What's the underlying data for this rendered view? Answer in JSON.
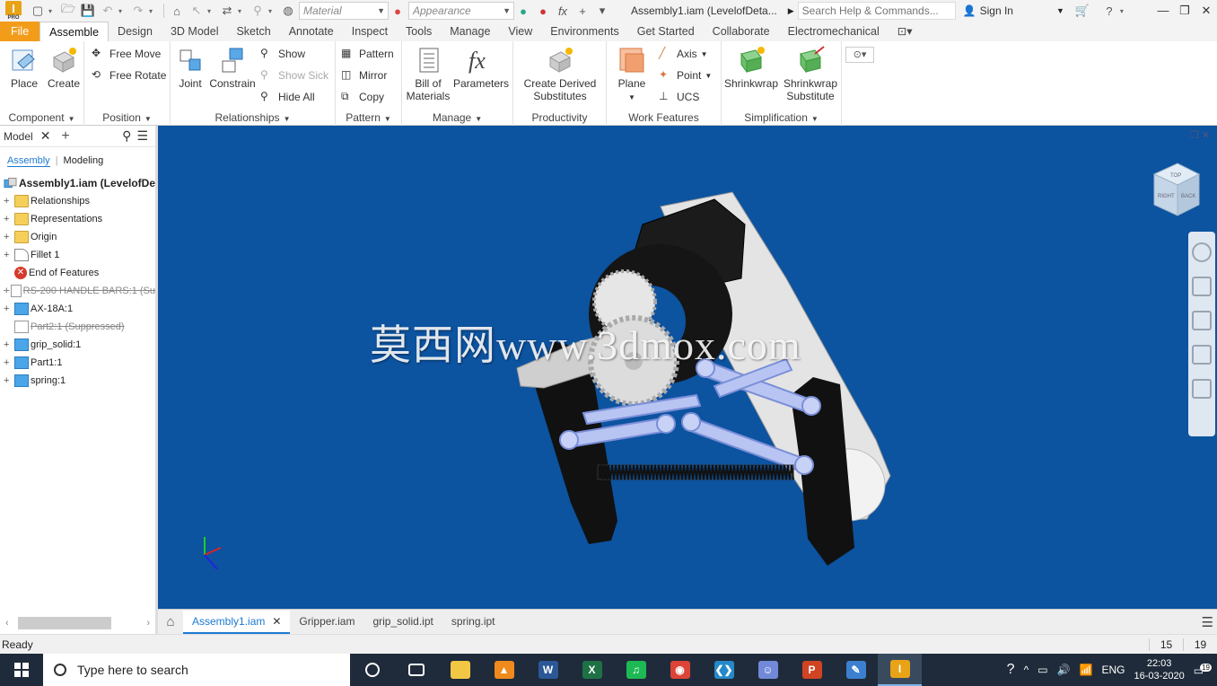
{
  "titlebar": {
    "material_placeholder": "Material",
    "appearance_placeholder": "Appearance",
    "document_title": "Assembly1.iam (LevelofDeta...",
    "search_placeholder": "Search Help & Commands...",
    "signin_label": "Sign In",
    "app_pro_label": "PRO"
  },
  "ribbon_tabs": [
    "File",
    "Assemble",
    "Design",
    "3D Model",
    "Sketch",
    "Annotate",
    "Inspect",
    "Tools",
    "Manage",
    "View",
    "Environments",
    "Get Started",
    "Collaborate",
    "Electromechanical"
  ],
  "ribbon": {
    "component": {
      "label": "Component",
      "place": "Place",
      "create": "Create"
    },
    "position": {
      "label": "Position",
      "free_move": "Free Move",
      "free_rotate": "Free Rotate"
    },
    "relationships": {
      "label": "Relationships",
      "joint": "Joint",
      "constrain": "Constrain",
      "show": "Show",
      "show_sick": "Show Sick",
      "hide_all": "Hide All"
    },
    "pattern": {
      "label": "Pattern",
      "pattern": "Pattern",
      "mirror": "Mirror",
      "copy": "Copy"
    },
    "manage": {
      "label": "Manage",
      "bom_1": "Bill of",
      "bom_2": "Materials",
      "parameters": "Parameters"
    },
    "productivity": {
      "label": "Productivity",
      "cds_1": "Create Derived",
      "cds_2": "Substitutes"
    },
    "work_features": {
      "label": "Work Features",
      "plane": "Plane",
      "axis": "Axis",
      "point": "Point",
      "ucs": "UCS"
    },
    "simplification": {
      "label": "Simplification",
      "shrinkwrap": "Shrinkwrap",
      "sws_1": "Shrinkwrap",
      "sws_2": "Substitute"
    }
  },
  "browser": {
    "title": "Model",
    "tab_assembly": "Assembly",
    "tab_modeling": "Modeling",
    "root": "Assembly1.iam (LevelofDe",
    "items": [
      {
        "label": "Relationships",
        "icon": "folder-icon",
        "expandable": true,
        "suppressed": false
      },
      {
        "label": "Representations",
        "icon": "representations-icon",
        "expandable": true,
        "suppressed": false
      },
      {
        "label": "Origin",
        "icon": "folder-icon",
        "expandable": true,
        "suppressed": false
      },
      {
        "label": "Fillet 1",
        "icon": "fillet-icon",
        "expandable": true,
        "suppressed": false
      },
      {
        "label": "End of Features",
        "icon": "error-icon",
        "expandable": false,
        "suppressed": false
      },
      {
        "label": "RS-200 HANDLE BARS:1 (Su",
        "icon": "part-icon",
        "expandable": true,
        "suppressed": true
      },
      {
        "label": "AX-18A:1",
        "icon": "part-icon",
        "expandable": true,
        "suppressed": false
      },
      {
        "label": "Part2:1 (Suppressed)",
        "icon": "part-icon",
        "expandable": false,
        "suppressed": true
      },
      {
        "label": "grip_solid:1",
        "icon": "part-icon",
        "expandable": true,
        "suppressed": false
      },
      {
        "label": "Part1:1",
        "icon": "part-icon",
        "expandable": true,
        "suppressed": false
      },
      {
        "label": "spring:1",
        "icon": "part-icon",
        "expandable": true,
        "suppressed": false
      }
    ]
  },
  "viewport": {
    "background": "#0c53a0",
    "watermark": "莫西网www.3dmox.com",
    "viewcube_top": "TOP",
    "viewcube_front": "RIGHT",
    "viewcube_back": "BACK"
  },
  "doc_tabs": [
    {
      "label": "Assembly1.iam",
      "active": true
    },
    {
      "label": "Gripper.iam",
      "active": false
    },
    {
      "label": "grip_solid.ipt",
      "active": false
    },
    {
      "label": "spring.ipt",
      "active": false
    }
  ],
  "status": {
    "text": "Ready",
    "count_a": "15",
    "count_b": "19"
  },
  "taskbar": {
    "search_placeholder": "Type here to search",
    "language": "ENG",
    "time": "22:03",
    "date": "16-03-2020",
    "notifications": "19",
    "apps": [
      {
        "name": "file-explorer",
        "color": "#f2c744",
        "glyph": ""
      },
      {
        "name": "vlc",
        "color": "#f08a1c",
        "glyph": "▲"
      },
      {
        "name": "word",
        "color": "#2b5797",
        "glyph": "W"
      },
      {
        "name": "excel",
        "color": "#1e7145",
        "glyph": "X"
      },
      {
        "name": "spotify",
        "color": "#1db954",
        "glyph": "♫"
      },
      {
        "name": "chrome",
        "color": "#db4437",
        "glyph": "◉"
      },
      {
        "name": "vscode",
        "color": "#2489ca",
        "glyph": "❮❯"
      },
      {
        "name": "discord",
        "color": "#7289da",
        "glyph": "☺"
      },
      {
        "name": "powerpoint",
        "color": "#d04423",
        "glyph": "P"
      },
      {
        "name": "paint",
        "color": "#3c7fd0",
        "glyph": "✎"
      },
      {
        "name": "inventor",
        "color": "#e8a317",
        "glyph": "I"
      }
    ]
  }
}
